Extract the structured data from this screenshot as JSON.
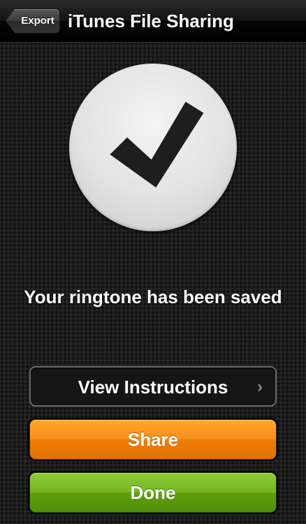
{
  "nav": {
    "back_label": "Export",
    "title": "iTunes File Sharing"
  },
  "status": {
    "icon": "checkmark-icon",
    "message": "Your ringtone has been saved"
  },
  "buttons": {
    "instructions_label": "View Instructions",
    "instructions_icon": "chevron-right-icon",
    "share_label": "Share",
    "done_label": "Done"
  },
  "colors": {
    "share": "#f39114",
    "done": "#6eb01a",
    "check_circle": "#e4e4e4",
    "check_mark": "#1e1e1e"
  }
}
